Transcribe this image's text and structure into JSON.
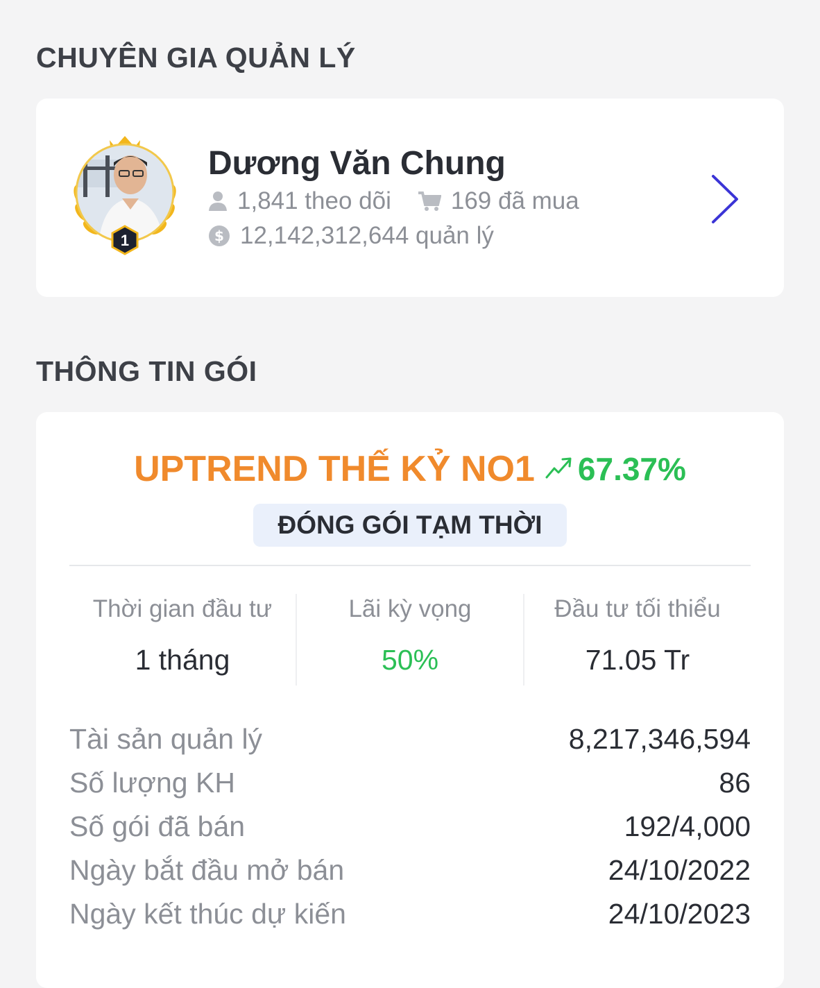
{
  "expert_section": {
    "title": "CHUYÊN GIA QUẢN LÝ",
    "expert": {
      "name": "Dương Văn Chung",
      "rank": "1",
      "followers": "1,841 theo dõi",
      "purchases": "169 đã mua",
      "managed": "12,142,312,644 quản lý",
      "icons": [
        "user-icon",
        "cart-icon",
        "dollar-coin-icon",
        "chevron-right-icon"
      ]
    }
  },
  "package_section": {
    "title": "THÔNG TIN GÓI",
    "package": {
      "name": "UPTREND THẾ KỶ NO1",
      "return": "67.37%",
      "status": "ĐÓNG GÓI TẠM THỜI",
      "metrics": [
        {
          "label": "Thời gian đầu tư",
          "value": "1 tháng"
        },
        {
          "label": "Lãi kỳ vọng",
          "value": "50%"
        },
        {
          "label": "Đầu tư tối thiểu",
          "value": "71.05 Tr"
        }
      ],
      "details": [
        {
          "label": "Tài sản quản lý",
          "value": "8,217,346,594"
        },
        {
          "label": "Số lượng KH",
          "value": "86"
        },
        {
          "label": "Số gói đã bán",
          "value": "192/4,000"
        },
        {
          "label": "Ngày bắt đầu mở bán",
          "value": "24/10/2022"
        },
        {
          "label": "Ngày kết thúc dự kiến",
          "value": "24/10/2023"
        }
      ]
    }
  },
  "colors": {
    "package_name": "#f08a2c",
    "positive": "#2bbf55",
    "chevron": "#3b34d6",
    "badge_bg": "#eaf0fb"
  }
}
